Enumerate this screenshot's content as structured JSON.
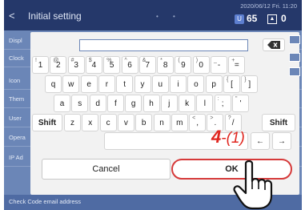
{
  "header": {
    "back_glyph": "<",
    "title": "Initial setting",
    "datetime": "2020/06/12 Fri. 11:20",
    "status_dots": "• •",
    "badge_a_count": "65",
    "badge_b_count": "0"
  },
  "background_rows": [
    {
      "label": "Displ"
    },
    {
      "label": "Clock"
    },
    {
      "label": "Icon"
    },
    {
      "label": "Them"
    },
    {
      "label": "User"
    },
    {
      "label": "Opera"
    },
    {
      "label": "IP Ad"
    }
  ],
  "bottom_row_label": "Check Code email address",
  "keyboard": {
    "row1": [
      {
        "main": "1",
        "shift": "!"
      },
      {
        "main": "2",
        "shift": "@"
      },
      {
        "main": "3",
        "shift": "#"
      },
      {
        "main": "4",
        "shift": "$"
      },
      {
        "main": "5",
        "shift": "%"
      },
      {
        "main": "6",
        "shift": "^"
      },
      {
        "main": "7",
        "shift": "&"
      },
      {
        "main": "8",
        "shift": "*"
      },
      {
        "main": "9",
        "shift": "("
      },
      {
        "main": "0",
        "shift": ")"
      },
      {
        "main": "-",
        "shift": "_"
      },
      {
        "main": "=",
        "shift": "+"
      }
    ],
    "row2": [
      {
        "main": "q",
        "shift": ""
      },
      {
        "main": "w",
        "shift": ""
      },
      {
        "main": "e",
        "shift": ""
      },
      {
        "main": "r",
        "shift": ""
      },
      {
        "main": "t",
        "shift": ""
      },
      {
        "main": "y",
        "shift": ""
      },
      {
        "main": "u",
        "shift": ""
      },
      {
        "main": "i",
        "shift": ""
      },
      {
        "main": "o",
        "shift": ""
      },
      {
        "main": "p",
        "shift": ""
      },
      {
        "main": "[",
        "shift": "{"
      },
      {
        "main": "]",
        "shift": "}"
      }
    ],
    "row3": [
      {
        "main": "a",
        "shift": ""
      },
      {
        "main": "s",
        "shift": ""
      },
      {
        "main": "d",
        "shift": ""
      },
      {
        "main": "f",
        "shift": ""
      },
      {
        "main": "g",
        "shift": ""
      },
      {
        "main": "h",
        "shift": ""
      },
      {
        "main": "j",
        "shift": ""
      },
      {
        "main": "k",
        "shift": ""
      },
      {
        "main": "l",
        "shift": ""
      },
      {
        "main": ";",
        "shift": ":"
      },
      {
        "main": "'",
        "shift": "\""
      }
    ],
    "row4_shift_left": "Shift",
    "row4": [
      {
        "main": "z",
        "shift": ""
      },
      {
        "main": "x",
        "shift": ""
      },
      {
        "main": "c",
        "shift": ""
      },
      {
        "main": "v",
        "shift": ""
      },
      {
        "main": "b",
        "shift": ""
      },
      {
        "main": "n",
        "shift": ""
      },
      {
        "main": "m",
        "shift": ""
      },
      {
        "main": ",",
        "shift": "<"
      },
      {
        "main": ".",
        "shift": ">"
      },
      {
        "main": "/",
        "shift": "?"
      }
    ],
    "row4_shift_right": "Shift",
    "arrow_left": "←",
    "arrow_right": "→",
    "text_value": ""
  },
  "buttons": {
    "cancel": "Cancel",
    "ok": "OK"
  },
  "annotation": {
    "step_num": "4",
    "step_sub": "-(1)"
  },
  "colors": {
    "accent_red": "#e0261f",
    "header_bg": "#25386a",
    "screen_bg": "#6b86b7"
  }
}
